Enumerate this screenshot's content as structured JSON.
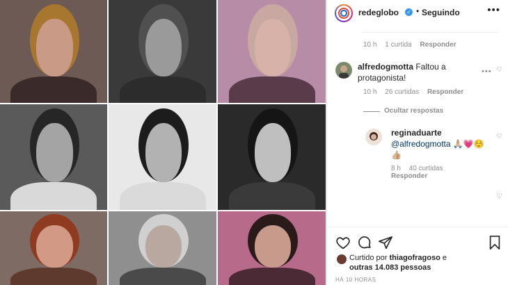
{
  "post_grid": {
    "tiles": [
      {
        "name": "photo-woman-red-hair",
        "bg": "#6d5a55",
        "hair": "#a8772f",
        "skin": "#c99a86",
        "body": "#3a2a2a"
      },
      {
        "name": "photo-man-gray-hair",
        "bg": "#3a3a3a",
        "hair": "#505050",
        "skin": "#9a9a9a",
        "body": "#2c2c2c"
      },
      {
        "name": "photo-woman-blonde-hair",
        "bg": "#b78ca6",
        "hair": "#c8a8a0",
        "skin": "#d7b2a8",
        "body": "#5a3b4a"
      },
      {
        "name": "photo-young-man-bw",
        "bg": "#5a5a5a",
        "hair": "#262626",
        "skin": "#a4a4a4",
        "body": "#d9d9d9"
      },
      {
        "name": "photo-young-woman-bw",
        "bg": "#e8e8e8",
        "hair": "#1c1c1c",
        "skin": "#b2b2b2",
        "body": "#dadada"
      },
      {
        "name": "photo-smiling-woman-bw",
        "bg": "#2a2a2a",
        "hair": "#151515",
        "skin": "#bfbfbf",
        "body": "#3a3a3a"
      },
      {
        "name": "photo-woman-auburn-hair",
        "bg": "#7e6b64",
        "hair": "#8e3b22",
        "skin": "#d29a84",
        "body": "#5e3a2e"
      },
      {
        "name": "photo-man-glasses",
        "bg": "#8f8f8f",
        "hair": "#d0d0d0",
        "skin": "#b8a8a0",
        "body": "#4a4a4a"
      },
      {
        "name": "photo-woman-dark-short-hair",
        "bg": "#b86a8a",
        "hair": "#2a1a1a",
        "skin": "#c79a8c",
        "body": "#4c2a35"
      }
    ]
  },
  "header": {
    "username": "redeglobo",
    "separator": "•",
    "follow_status": "Seguindo",
    "more": "•••"
  },
  "comments": {
    "first_meta": {
      "time": "10 h",
      "likes": "1 curtida",
      "reply": "Responder"
    },
    "second": {
      "username": "alfredogmotta",
      "text": " Faltou a protagonista!",
      "meta": {
        "time": "10 h",
        "likes": "26 curtidas",
        "reply": "Responder"
      }
    },
    "hide_replies": "Ocultar respostas",
    "reply": {
      "username": "reginaduarte",
      "mention": "@alfredogmotta",
      "emojis": " 🙏🏼💗☺️",
      "emojis2": "👍🏼",
      "meta": {
        "time": "8 h",
        "likes": "40 curtidas",
        "reply": "Responder"
      }
    },
    "dots": "•••",
    "heart": "♡"
  },
  "actions": {
    "liked_prefix": "Curtido por ",
    "liked_user": "thiagofragoso",
    "liked_mid": " e ",
    "liked_others": "outras 14.083 pessoas",
    "timestamp": "HÁ 10 HORAS"
  },
  "colors": {
    "verified": "#3897f0",
    "mention": "#00376b",
    "muted": "#8e8e8e",
    "text": "#262626"
  }
}
